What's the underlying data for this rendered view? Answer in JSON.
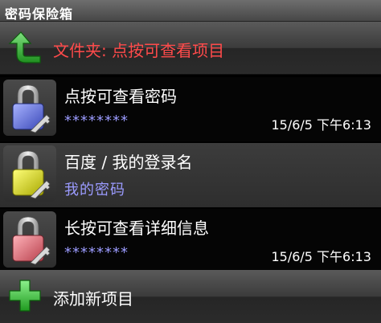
{
  "titlebar": {
    "title": "密码保险箱"
  },
  "folder_bar": {
    "label": "文件夹: 点按可查看项目",
    "icon": "back-arrow-icon",
    "color": "#ff4b4b"
  },
  "entries": [
    {
      "title": "点按可查看密码",
      "password": "********",
      "date": "15/6/5 下午6:13",
      "lock_color": "#6f7fe0",
      "icon": "blue-lock-icon"
    },
    {
      "title": "百度 / 我的登录名",
      "password": "我的密码",
      "date": "",
      "lock_color": "#d8d82a",
      "icon": "yellow-lock-icon"
    },
    {
      "title": "长按可查看详细信息",
      "password": "********",
      "date": "15/6/5 下午6:13",
      "lock_color": "#e07a84",
      "icon": "red-lock-icon"
    }
  ],
  "add_bar": {
    "label": "添加新项目",
    "icon": "plus-icon",
    "color": "#3fc23f"
  }
}
